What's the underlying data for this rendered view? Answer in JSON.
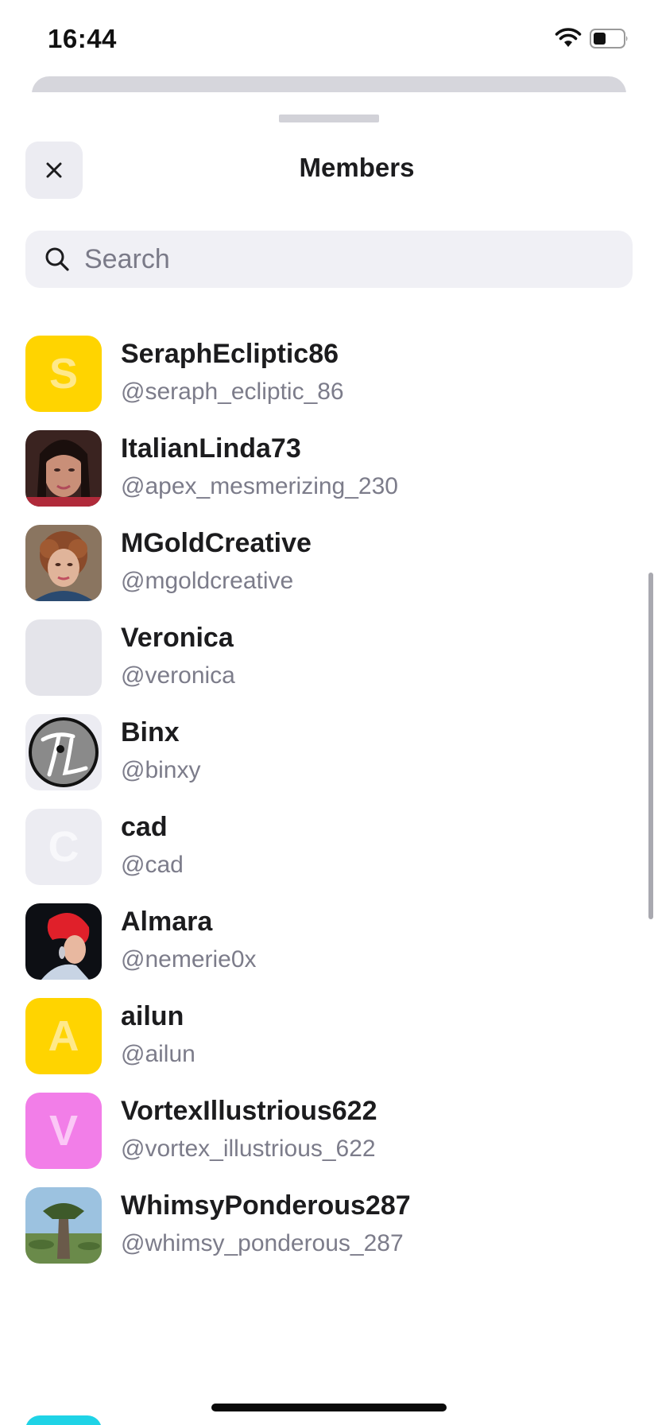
{
  "status_bar": {
    "time": "16:44"
  },
  "header": {
    "title": "Members",
    "close_icon": "close-icon"
  },
  "search": {
    "placeholder": "Search",
    "value": ""
  },
  "members": [
    {
      "name": "SeraphEcliptic86",
      "handle": "@seraph_ecliptic_86",
      "avatar": {
        "type": "letter",
        "letter": "S",
        "bg": "#ffd400",
        "fg": "#ffe98a"
      }
    },
    {
      "name": "ItalianLinda73",
      "handle": "@apex_mesmerizing_230",
      "avatar": {
        "type": "photo",
        "icon": "portrait-photo"
      }
    },
    {
      "name": "MGoldCreative",
      "handle": "@mgoldcreative",
      "avatar": {
        "type": "photo",
        "icon": "portrait-photo"
      }
    },
    {
      "name": "Veronica",
      "handle": "@veronica",
      "avatar": {
        "type": "blank",
        "bg": "#e4e4ea"
      }
    },
    {
      "name": "Binx",
      "handle": "@binxy",
      "avatar": {
        "type": "logo",
        "letter": "TL",
        "bg": "#ececf2"
      }
    },
    {
      "name": "cad",
      "handle": "@cad",
      "avatar": {
        "type": "letter",
        "letter": "C",
        "bg": "#ececf2",
        "fg": "#f8f8fb"
      }
    },
    {
      "name": "Almara",
      "handle": "@nemerie0x",
      "avatar": {
        "type": "photo",
        "icon": "portrait-photo"
      }
    },
    {
      "name": "ailun",
      "handle": "@ailun",
      "avatar": {
        "type": "letter",
        "letter": "A",
        "bg": "#ffd400",
        "fg": "#ffe98a"
      }
    },
    {
      "name": "VortexIllustrious622",
      "handle": "@vortex_illustrious_622",
      "avatar": {
        "type": "letter",
        "letter": "V",
        "bg": "#f27ee8",
        "fg": "#fbc8f6"
      }
    },
    {
      "name": "WhimsyPonderous287",
      "handle": "@whimsy_ponderous_287",
      "avatar": {
        "type": "photo",
        "icon": "baobab-tree-photo"
      }
    }
  ],
  "colors": {
    "accent_yellow": "#ffd400",
    "accent_pink": "#f27ee8",
    "accent_cyan": "#1fd3e6",
    "secondary_text": "#7c7c8a"
  }
}
